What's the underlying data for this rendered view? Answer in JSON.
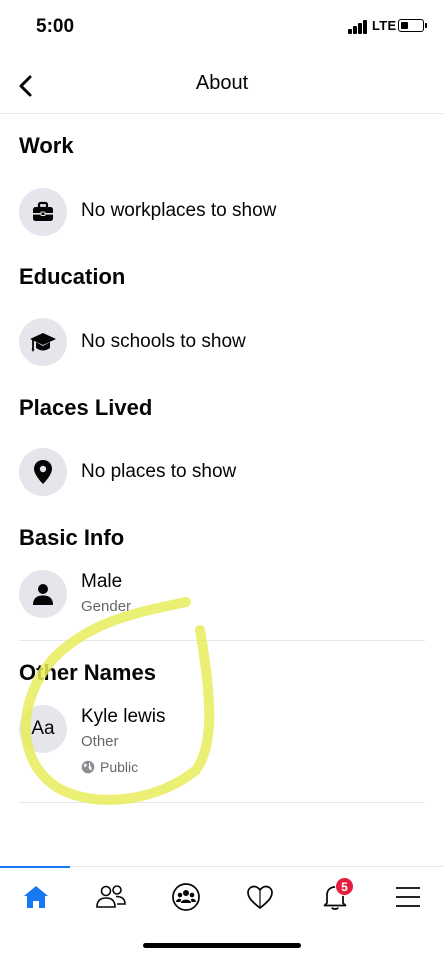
{
  "status_bar": {
    "time": "5:00",
    "network": "LTE"
  },
  "nav": {
    "title": "About"
  },
  "sections": {
    "work": {
      "title": "Work",
      "text": "No workplaces to show"
    },
    "education": {
      "title": "Education",
      "text": "No schools to show"
    },
    "places": {
      "title": "Places Lived",
      "text": "No places to show"
    },
    "basic_info": {
      "title": "Basic Info",
      "value": "Male",
      "label": "Gender"
    },
    "other_names": {
      "title": "Other Names",
      "icon_text": "Aa",
      "value": "Kyle lewis",
      "label": "Other",
      "privacy": "Public"
    }
  },
  "tab_bar": {
    "tabs": [
      {
        "icon": "home-icon",
        "active": true
      },
      {
        "icon": "friends-icon",
        "active": false
      },
      {
        "icon": "groups-icon",
        "active": false
      },
      {
        "icon": "dating-icon",
        "active": false
      },
      {
        "icon": "notifications-icon",
        "active": false,
        "badge": "5"
      },
      {
        "icon": "menu-icon",
        "active": false
      }
    ]
  },
  "colors": {
    "accent": "#1877f2",
    "badge": "#e41e3f",
    "highlight": "#e8ec5a",
    "secondary_text": "#65676b"
  }
}
